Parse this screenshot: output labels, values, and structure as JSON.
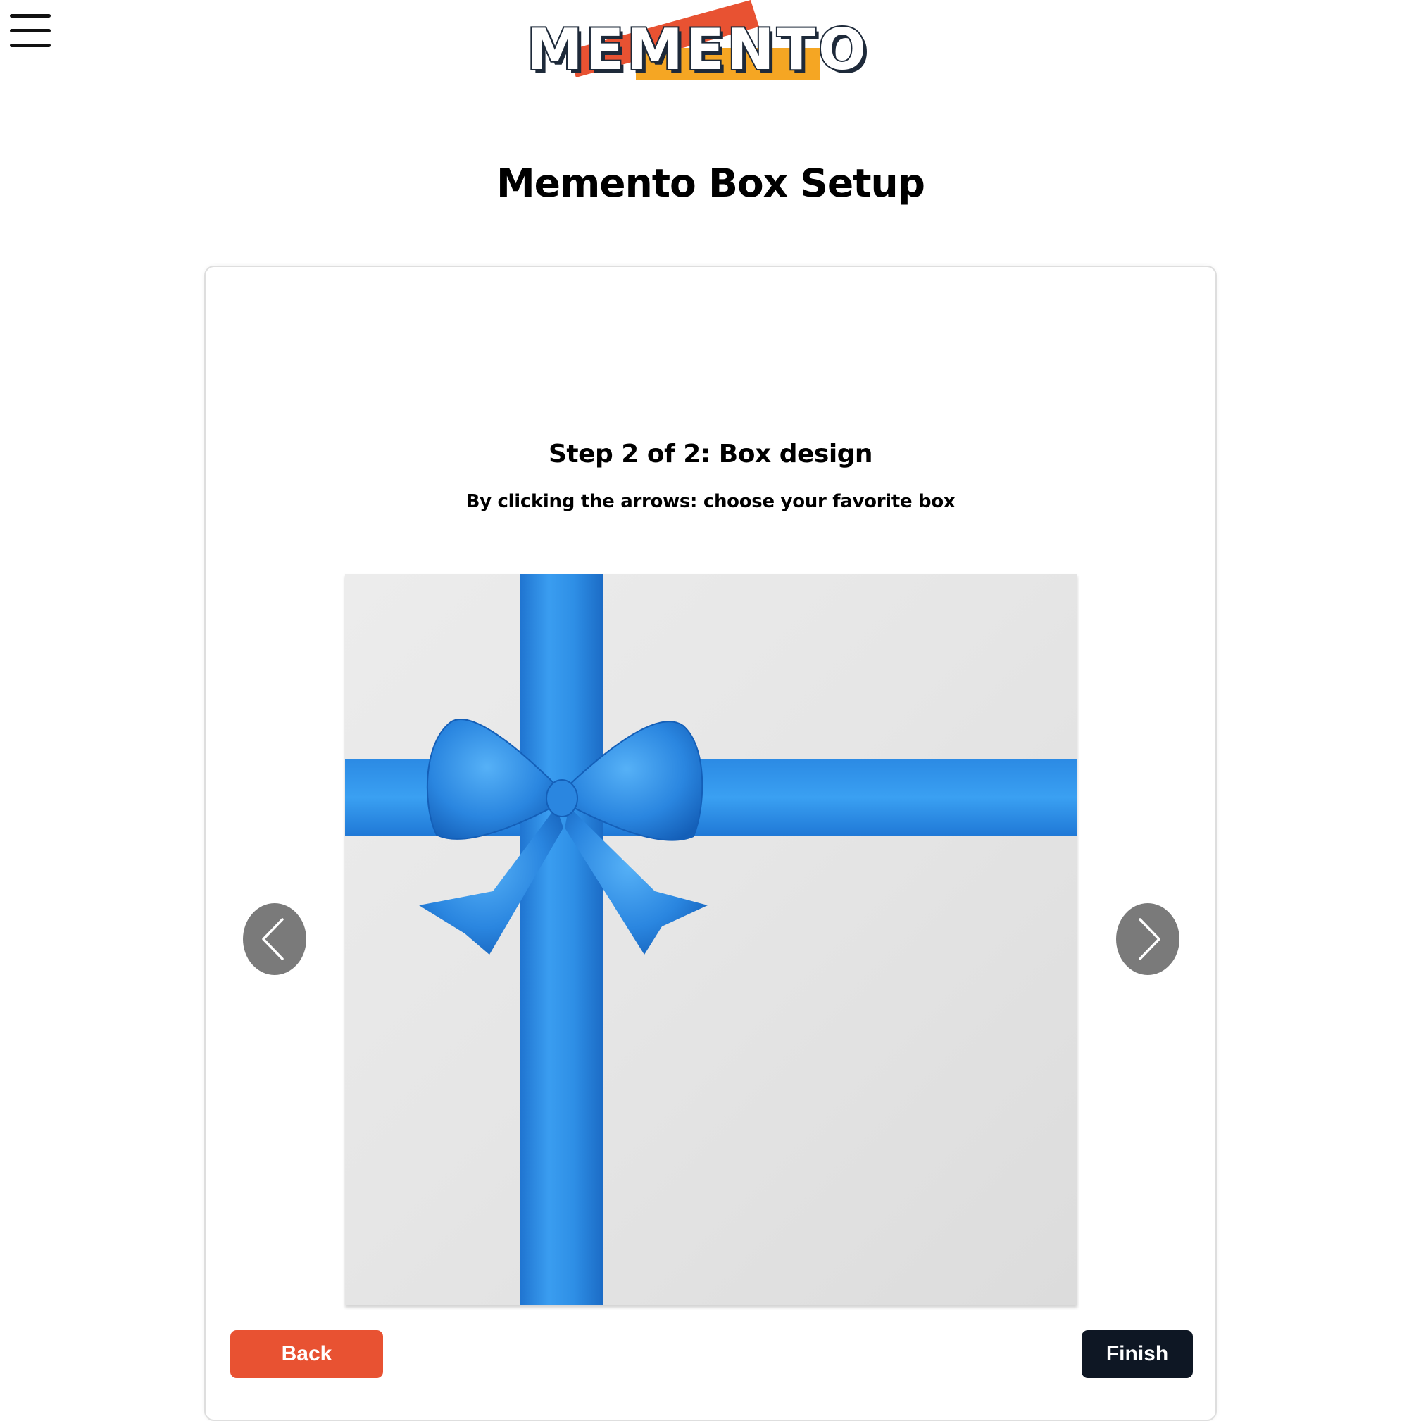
{
  "header": {
    "menu_icon": "hamburger-menu-icon",
    "logo_text": "MEMENTO"
  },
  "page": {
    "title": "Memento Box Setup"
  },
  "step": {
    "title": "Step 2 of 2: Box design",
    "subtitle": "By clicking the arrows: choose your favorite box"
  },
  "carousel": {
    "image_alt": "White gift box with blue ribbon and bow",
    "prev_icon": "chevron-left-icon",
    "next_icon": "chevron-right-icon",
    "ribbon_color": "#2f8fe6"
  },
  "actions": {
    "back_label": "Back",
    "finish_label": "Finish"
  },
  "colors": {
    "accent_orange": "#e85232",
    "accent_yellow": "#f5a623",
    "dark": "#0e1724",
    "arrow_gray": "#7a7a7a"
  }
}
